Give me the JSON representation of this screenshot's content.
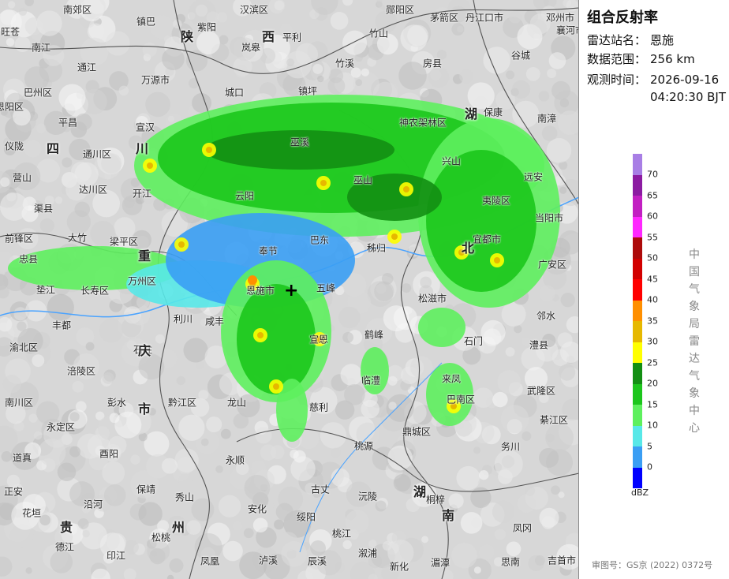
{
  "panel": {
    "title": "组合反射率",
    "station_label": "雷达站名：",
    "station": "恩施",
    "range_label": "数据范围：",
    "range": "256 km",
    "time_label": "观测时间：",
    "time_date": "2026-09-16",
    "time_clock": "04:20:30 BJT",
    "legend_unit": "dBZ",
    "legend_values": [
      "70",
      "65",
      "60",
      "55",
      "50",
      "45",
      "40",
      "35",
      "30",
      "25",
      "20",
      "15",
      "10",
      "5",
      "0"
    ],
    "legend_colors": [
      "#a87ee5",
      "#8c1ba2",
      "#c21fc2",
      "#ff28ff",
      "#ad0a0a",
      "#d20000",
      "#ff0000",
      "#ff8f00",
      "#e6b800",
      "#ffff00",
      "#138f13",
      "#1cc61c",
      "#5ef05e",
      "#58e8e8",
      "#3a9ef4",
      "#0000ff"
    ],
    "vertical_org": [
      "中",
      "国",
      "气",
      "象",
      "局",
      "雷",
      "达",
      "气",
      "象",
      "中",
      "心"
    ],
    "approval": "审图号：GS京 (2022) 0372号"
  },
  "map": {
    "center_marker": "+",
    "provinces": [
      "陕",
      "西",
      "湖",
      "北",
      "四",
      "川",
      "重",
      "庆",
      "市",
      "贵",
      "州",
      "湖",
      "南"
    ],
    "places": [
      "南郊区",
      "镇巴",
      "汉滨区",
      "郧阳区",
      "茅箭区",
      "丹江口市",
      "邓州市",
      "襄河市",
      "旺苍",
      "紫阳",
      "平利",
      "竹山",
      "谷城",
      "南江",
      "通江",
      "岚皋",
      "竹溪",
      "房县",
      "恩阳区",
      "巴州区",
      "万源市",
      "城口",
      "镇坪",
      "保康",
      "南漳",
      "平昌",
      "宣汉",
      "神农架林区",
      "巫溪",
      "兴山",
      "远安",
      "仪陇",
      "通川区",
      "达川区",
      "开江",
      "云阳",
      "巫山",
      "秭归",
      "夷陵区",
      "当阳市",
      "营山",
      "渠县",
      "大竹",
      "梁平区",
      "奉节",
      "巴东",
      "宜都市",
      "广安区",
      "前锋区",
      "忠县",
      "万州区",
      "恩施市",
      "五峰",
      "松滋市",
      "邻水",
      "垫江",
      "长寿区",
      "丰都",
      "石柱",
      "利川",
      "咸丰",
      "石门",
      "澧县",
      "渝北区",
      "涪陵区",
      "宣恩",
      "鹤峰",
      "来凤",
      "临澧",
      "武隆区",
      "彭水",
      "黔江区",
      "龙山",
      "慈利",
      "巴南区",
      "南川区",
      "永定区",
      "鼎城区",
      "綦江区",
      "道真",
      "酉阳",
      "永顺",
      "桃源",
      "务川",
      "保靖",
      "古丈",
      "沅陵",
      "桐梓",
      "正安",
      "沿河",
      "秀山",
      "花垣",
      "安化",
      "绥阳",
      "凤冈",
      "德江",
      "印江",
      "松桃",
      "凤凰",
      "泸溪",
      "辰溪",
      "溆浦",
      "新化",
      "湄潭",
      "思南",
      "吉首市",
      "桃江"
    ]
  }
}
